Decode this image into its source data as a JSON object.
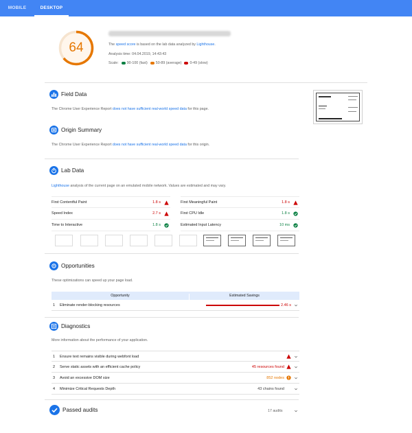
{
  "tabs": [
    {
      "label": "MOBILE",
      "active": false
    },
    {
      "label": "DESKTOP",
      "active": true
    }
  ],
  "score": {
    "value": "64",
    "fraction": 0.64,
    "color": "#e67700"
  },
  "summary": {
    "line1_pre": "The ",
    "line1_link": "speed score",
    "line1_mid": " is based on the lab data analyzed by ",
    "line1_link2": "Lighthouse",
    "line1_post": ".",
    "analysis_time": "Analysis time: 04.04.2019, 14:43:43",
    "scale_label": "Scale:",
    "scale_fast": "90-100 (fast)",
    "scale_average": "50-89 (average)",
    "scale_slow": "0-49 (slow)",
    "colors": {
      "fast": "#0b8043",
      "average": "#e67700",
      "slow": "#c00"
    }
  },
  "field_data": {
    "title": "Field Data",
    "desc_pre": "The Chrome User Experience Report ",
    "desc_link": "does not have sufficient real-world speed data",
    "desc_post": " for this page."
  },
  "origin_summary": {
    "title": "Origin Summary",
    "desc_pre": "The Chrome User Experience Report ",
    "desc_link": "does not have sufficient real-world speed data",
    "desc_post": " for this origin."
  },
  "lab_data": {
    "title": "Lab Data",
    "desc_link": "Lighthouse",
    "desc_post": " analysis of the current page on an emulated mobile network. Values are estimated and may vary.",
    "metrics": [
      {
        "name": "First Contentful Paint",
        "value": "1.8 s",
        "status": "slow"
      },
      {
        "name": "First Meaningful Paint",
        "value": "1.8 s",
        "status": "slow"
      },
      {
        "name": "Speed Index",
        "value": "2.7 s",
        "status": "slow"
      },
      {
        "name": "First CPU Idle",
        "value": "1.8 s",
        "status": "fast"
      },
      {
        "name": "Time to Interactive",
        "value": "1.8 s",
        "status": "fast"
      },
      {
        "name": "Estimated Input Latency",
        "value": "10 ms",
        "status": "fast"
      }
    ]
  },
  "opportunities": {
    "title": "Opportunities",
    "desc": "These optimizations can speed up your page load.",
    "col_opportunity": "Opportunity",
    "col_savings": "Estimated Savings",
    "rows": [
      {
        "num": "1",
        "text": "Eliminate render-blocking resources",
        "value": "2.46 s"
      }
    ]
  },
  "diagnostics": {
    "title": "Diagnostics",
    "desc": "More information about the performance of your application.",
    "rows": [
      {
        "num": "1",
        "text": "Ensure text remains visible during webfont load",
        "value": "",
        "status": "slow"
      },
      {
        "num": "2",
        "text": "Serve static assets with an efficient cache policy",
        "value": "45 resources found",
        "status": "slow"
      },
      {
        "num": "3",
        "text": "Avoid an excessive DOM size",
        "value": "852 nodes",
        "status": "average"
      },
      {
        "num": "4",
        "text": "Minimize Critical Requests Depth",
        "value": "43 chains found",
        "status": "none"
      }
    ]
  },
  "passed": {
    "title": "Passed audits",
    "count": "17 audits"
  }
}
